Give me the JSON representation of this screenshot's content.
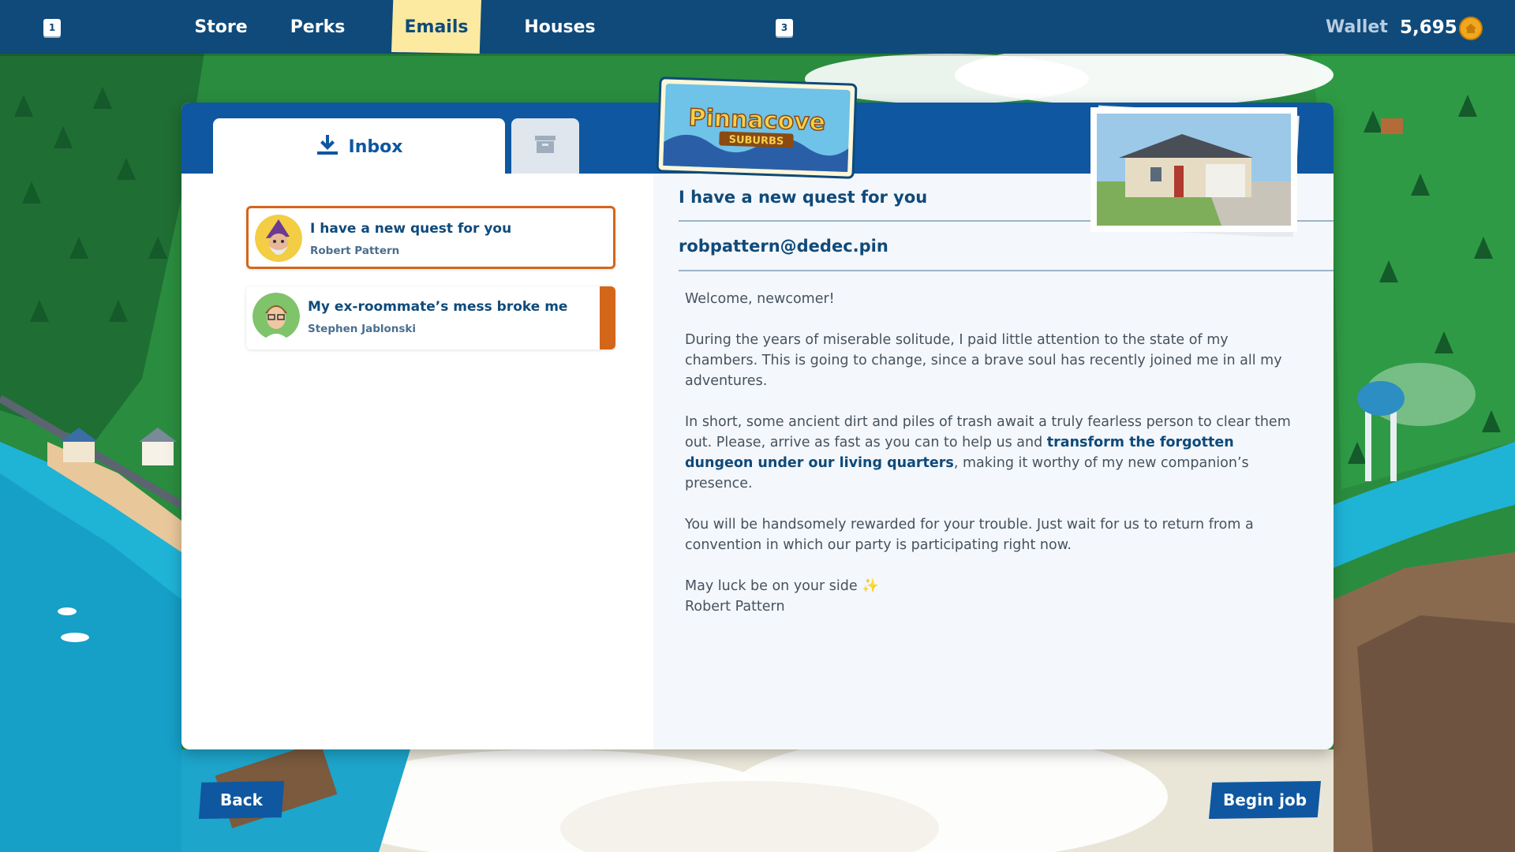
{
  "topbar": {
    "left_key": "1",
    "right_key": "3",
    "tabs": [
      {
        "label": "Store"
      },
      {
        "label": "Perks"
      },
      {
        "label": "Emails"
      },
      {
        "label": "Houses"
      }
    ],
    "active_tab": "Emails",
    "wallet_label": "Wallet",
    "wallet_amount": "5,695"
  },
  "panel": {
    "inbox_tab_label": "Inbox",
    "archive_tab_icon": "archive-icon",
    "logo_text_main": "Pinnacove",
    "logo_text_sub": "SUBURBS"
  },
  "emails": [
    {
      "subject": "I have a new quest for you",
      "sender": "Robert Pattern",
      "selected": true,
      "unread": false
    },
    {
      "subject": "My ex-roommate’s mess broke me",
      "sender": "Stephen Jablonski",
      "selected": false,
      "unread": true
    }
  ],
  "reading": {
    "subject": "I have a new quest for you",
    "from": "robpattern@dedec.pin",
    "greeting": "Welcome, newcomer!",
    "p1": "During the years of miserable solitude, I paid little attention to the state of my chambers. This is going to change, since a brave soul has recently joined me in all my adventures.",
    "p2_a": "In short, some ancient dirt and piles of trash await a truly fearless person to clear them out. Please, arrive as fast as you can to help us and ",
    "p2_link": "transform the forgotten dungeon under our living quarters",
    "p2_b": ", making it worthy of my new companion’s presence.",
    "p3": "You will be handsomely rewarded for your trouble. Just wait for us to return from a convention in which our party is participating right now.",
    "closing": "May luck be on your side",
    "closing_emoji": "✨",
    "signature": "Robert Pattern"
  },
  "buttons": {
    "back": "Back",
    "begin": "Begin job"
  },
  "colors": {
    "topbar": "#0f4a7a",
    "panel_header": "#0f57a0",
    "accent_orange": "#d4661a",
    "active_tab": "#fbeaa0",
    "coin": "#f2a81c"
  }
}
